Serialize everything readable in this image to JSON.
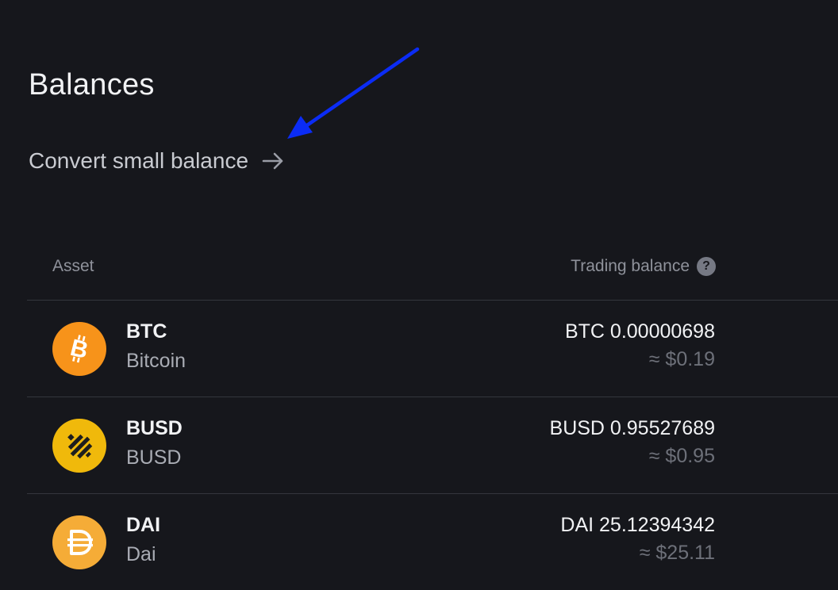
{
  "page": {
    "title": "Balances",
    "convert_label": "Convert small balance"
  },
  "table": {
    "col_asset": "Asset",
    "col_balance": "Trading balance",
    "help_glyph": "?"
  },
  "rows": [
    {
      "symbol": "BTC",
      "name": "Bitcoin",
      "amount": "BTC 0.00000698",
      "usd": "≈ $0.19",
      "icon": "bitcoin-icon",
      "icon_color": "#f7931a"
    },
    {
      "symbol": "BUSD",
      "name": "BUSD",
      "amount": "BUSD 0.95527689",
      "usd": "≈ $0.95",
      "icon": "busd-icon",
      "icon_color": "#f0b90b"
    },
    {
      "symbol": "DAI",
      "name": "Dai",
      "amount": "DAI 25.12394342",
      "usd": "≈ $25.11",
      "icon": "dai-icon",
      "icon_color": "#f5ac37"
    }
  ],
  "colors": {
    "background": "#16171c",
    "annotation_arrow": "#0b2cf5"
  }
}
